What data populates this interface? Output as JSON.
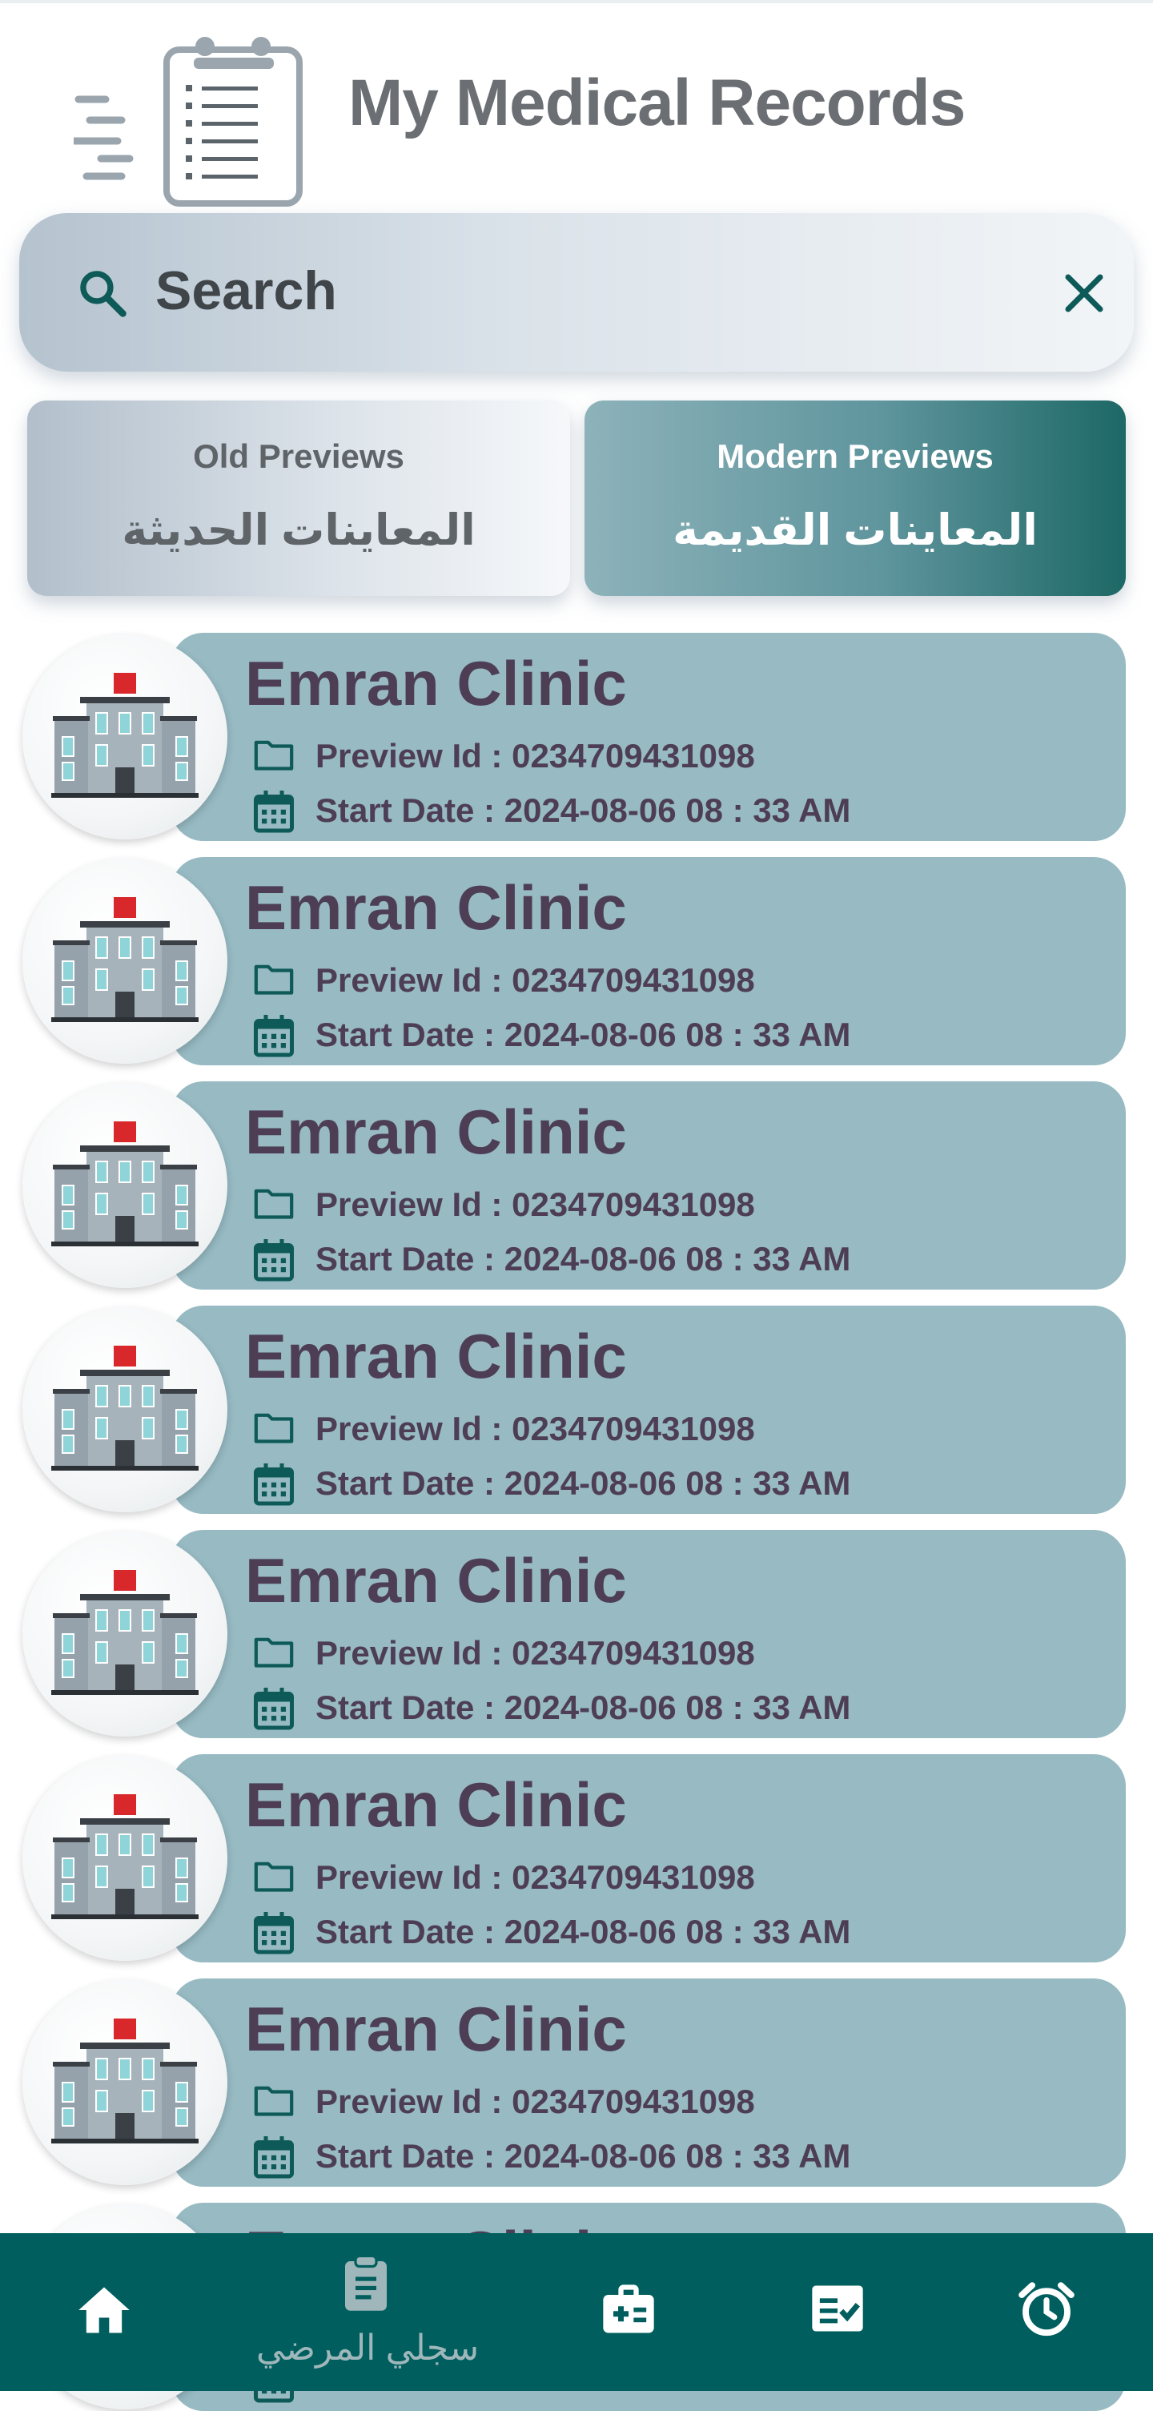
{
  "header": {
    "title": "My Medical Records",
    "logo_icon": "clipboard-list-icon"
  },
  "search": {
    "placeholder": "Search",
    "search_icon": "search-icon",
    "clear_icon": "close-icon"
  },
  "tabs": [
    {
      "label_en": "Old Previews",
      "label_ar": "المعاينات الحديثة",
      "active": false
    },
    {
      "label_en": "Modern Previews",
      "label_ar": "المعاينات القديمة",
      "active": true
    }
  ],
  "records": [
    {
      "clinic": "Emran Clinic",
      "preview_id": "Preview Id : 0234709431098",
      "start_date": "Start Date : 2024-08-06  08 : 33 AM"
    },
    {
      "clinic": "Emran Clinic",
      "preview_id": "Preview Id : 0234709431098",
      "start_date": "Start Date : 2024-08-06  08 : 33 AM"
    },
    {
      "clinic": "Emran Clinic",
      "preview_id": "Preview Id : 0234709431098",
      "start_date": "Start Date : 2024-08-06  08 : 33 AM"
    },
    {
      "clinic": "Emran Clinic",
      "preview_id": "Preview Id : 0234709431098",
      "start_date": "Start Date : 2024-08-06  08 : 33 AM"
    },
    {
      "clinic": "Emran Clinic",
      "preview_id": "Preview Id : 0234709431098",
      "start_date": "Start Date : 2024-08-06  08 : 33 AM"
    },
    {
      "clinic": "Emran Clinic",
      "preview_id": "Preview Id : 0234709431098",
      "start_date": "Start Date : 2024-08-06  08 : 33 AM"
    },
    {
      "clinic": "Emran Clinic",
      "preview_id": "Preview Id : 0234709431098",
      "start_date": "Start Date : 2024-08-06  08 : 33 AM"
    },
    {
      "clinic": "Emran Clinic",
      "preview_id": "",
      "start_date": ""
    }
  ],
  "nav": {
    "items": [
      {
        "icon": "home-icon"
      },
      {
        "icon": "clipboard-icon",
        "label": "سجلي المرضي",
        "active": true
      },
      {
        "icon": "medical-kit-icon"
      },
      {
        "icon": "task-list-icon"
      },
      {
        "icon": "alarm-clock-icon"
      }
    ]
  },
  "colors": {
    "primary": "#005f5e",
    "card": "#97bac3",
    "card_text": "#4d3e55",
    "title": "#6b6e72"
  }
}
